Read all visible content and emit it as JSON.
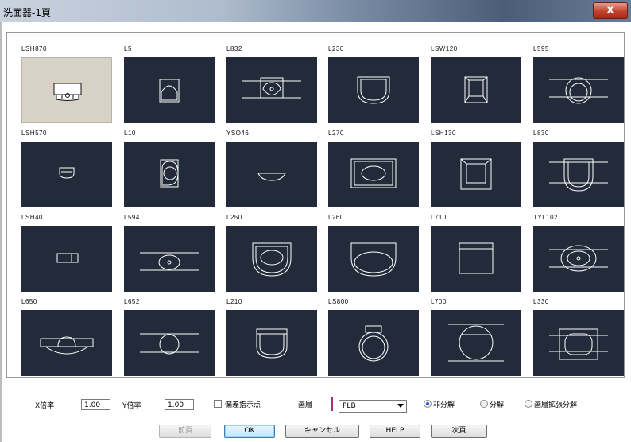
{
  "window": {
    "title": "洗面器-1頁",
    "close_label": "x"
  },
  "items": [
    {
      "label": "LSH870",
      "shape": "lsh870",
      "selected": true
    },
    {
      "label": "L5",
      "shape": "l5"
    },
    {
      "label": "L832",
      "shape": "l832"
    },
    {
      "label": "L230",
      "shape": "l230"
    },
    {
      "label": "LSW120",
      "shape": "lsw120"
    },
    {
      "label": "L595",
      "shape": "l595"
    },
    {
      "label": "LSH570",
      "shape": "lsh570"
    },
    {
      "label": "L10",
      "shape": "l10"
    },
    {
      "label": "YSO46",
      "shape": "yso46"
    },
    {
      "label": "L270",
      "shape": "l270"
    },
    {
      "label": "LSH130",
      "shape": "lsh130"
    },
    {
      "label": "L830",
      "shape": "l830"
    },
    {
      "label": "LSH40",
      "shape": "lsh40"
    },
    {
      "label": "L594",
      "shape": "l594"
    },
    {
      "label": "L250",
      "shape": "l250"
    },
    {
      "label": "L260",
      "shape": "l260"
    },
    {
      "label": "L710",
      "shape": "l710"
    },
    {
      "label": "TYL102",
      "shape": "tyl102"
    },
    {
      "label": "L650",
      "shape": "l650"
    },
    {
      "label": "L652",
      "shape": "l652"
    },
    {
      "label": "L210",
      "shape": "l210"
    },
    {
      "label": "LS800",
      "shape": "ls800"
    },
    {
      "label": "L700",
      "shape": "l700"
    },
    {
      "label": "L330",
      "shape": "l330"
    }
  ],
  "controls": {
    "x_scale_label": "X倍率",
    "x_scale_value": "1.00",
    "y_scale_label": "Y倍率",
    "y_scale_value": "1.00",
    "offset_point_label": "偏差指示点",
    "layer_label": "画層",
    "layer_value": "PLB",
    "layer_color": "#b0307f",
    "radio_no_explode": "非分解",
    "radio_explode": "分解",
    "radio_layer_explode": "画層拡張分解",
    "radio_selected": "no_explode"
  },
  "buttons": {
    "prev": "前頁",
    "ok": "OK",
    "cancel": "キャンセル",
    "help": "HELP",
    "next": "次頁"
  }
}
